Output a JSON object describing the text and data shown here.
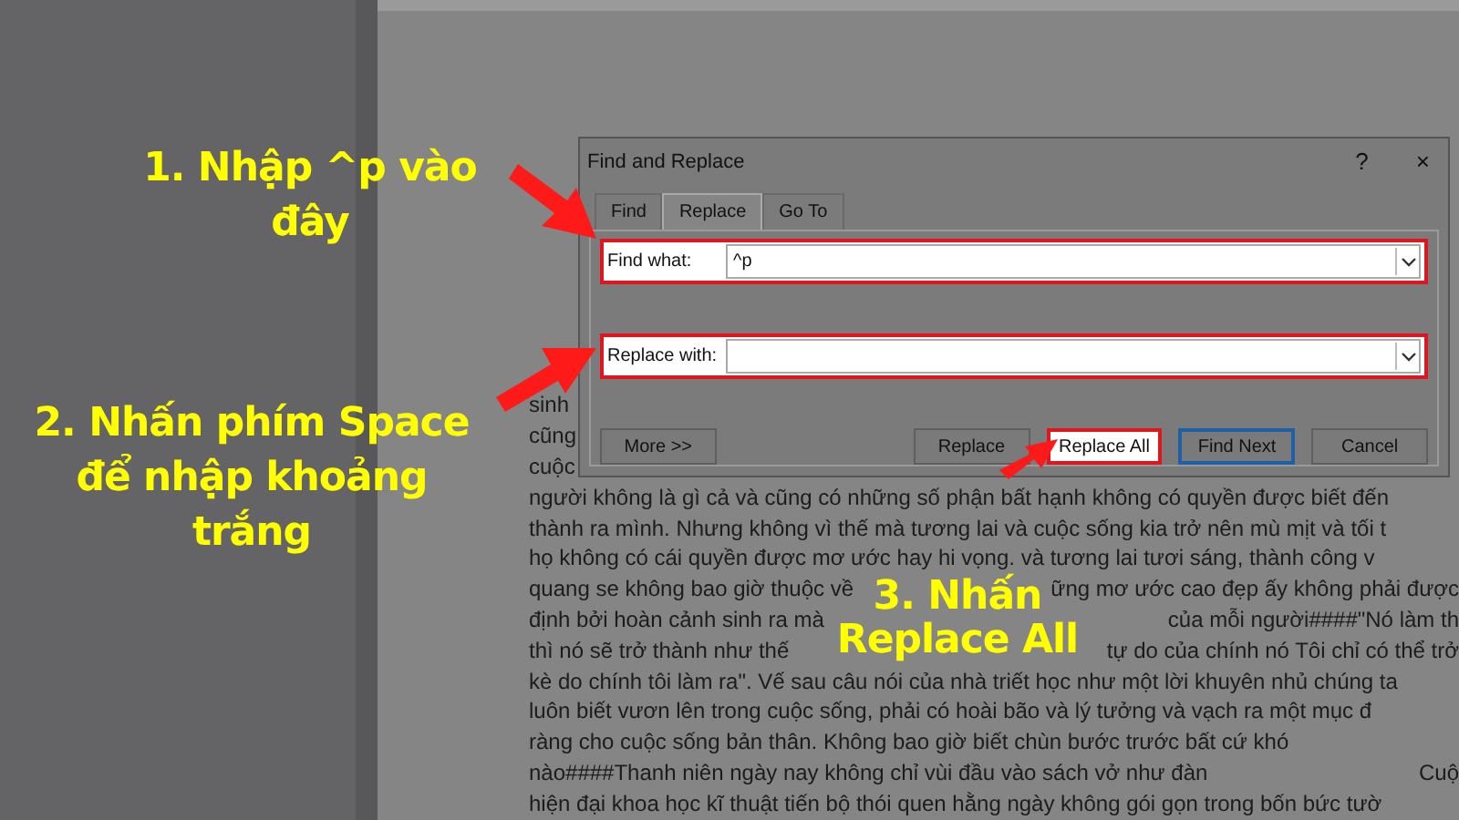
{
  "document": {
    "lines": [
      {
        "segments": [
          "sinh"
        ]
      },
      {
        "segments": [
          "cũng"
        ]
      },
      {
        "segments": [
          "cuộc"
        ]
      },
      {
        "segments": [
          "người không là gì cả và cũng có những số phận bất hạnh không có quyền được biết đến"
        ]
      },
      {
        "segments": [
          "thành ra mình. Nhưng không vì thế mà tương lai và cuộc sống kia trở nên mù mịt và tối t"
        ]
      },
      {
        "segments": [
          "họ không có cái quyền được mơ ước hay hi vọng. và tương lai tươi sáng, thành công v"
        ]
      },
      {
        "segments": [
          "quang se không bao giờ thuộc về",
          "ững mơ ước cao đẹp ấy không phải được"
        ]
      },
      {
        "segments": [
          "định bởi hoàn cảnh sinh ra mà",
          "của mỗi người####\"Nó làm th"
        ]
      },
      {
        "segments": [
          "thì nó sẽ trở thành như thế",
          "tự do của chính nó Tôi chỉ có thể trở"
        ]
      },
      {
        "segments": [
          "kè do chính tôi làm ra\". Vế sau câu nói của nhà triết học như một lời khuyên nhủ chúng ta"
        ]
      },
      {
        "segments": [
          "luôn biết vươn lên trong cuộc sống, phải có hoài bão và lý tưởng và vạch ra một mục đ"
        ]
      },
      {
        "segments": [
          "ràng cho cuộc sống bản thân. Không bao giờ biết chùn bước trước bất cứ khó"
        ]
      },
      {
        "segments": [
          "nào####Thanh niên ngày nay không chỉ vùi đầu vào sách vở như đàn",
          "Cuộ"
        ]
      },
      {
        "segments": [
          "hiện đại khoa học kĩ thuật tiến bộ thói quen hằng ngày không gói gọn trong bốn bức tườ"
        ]
      }
    ]
  },
  "dialog": {
    "title": "Find and Replace",
    "help": "?",
    "close": "×",
    "tabs": [
      {
        "label": "Find",
        "selected": false
      },
      {
        "label": "Replace",
        "selected": true
      },
      {
        "label": "Go To",
        "selected": false
      }
    ],
    "fields": [
      {
        "label": "Find what:",
        "value": "^p",
        "highlighted": true
      },
      {
        "label": "Replace with:",
        "highlighted": true
      }
    ],
    "buttons": [
      {
        "label": "More >>",
        "highlighted": false,
        "default": false
      },
      {
        "label": "Replace",
        "highlighted": false,
        "default": false
      },
      {
        "label": "Replace All",
        "highlighted": true,
        "default": false
      },
      {
        "label": "Find Next",
        "highlighted": false,
        "default": true
      },
      {
        "label": "Cancel",
        "highlighted": false,
        "default": false
      }
    ]
  },
  "annotations": [
    {
      "kind": "step1",
      "lines": [
        "1. Nhập ^p vào",
        "đây"
      ]
    },
    {
      "kind": "step2",
      "lines": [
        "2. Nhấn phím Space",
        "để nhập khoảng",
        "trắng"
      ]
    },
    {
      "kind": "step3",
      "lines": [
        "3. Nhấn",
        "Replace All"
      ]
    }
  ]
}
